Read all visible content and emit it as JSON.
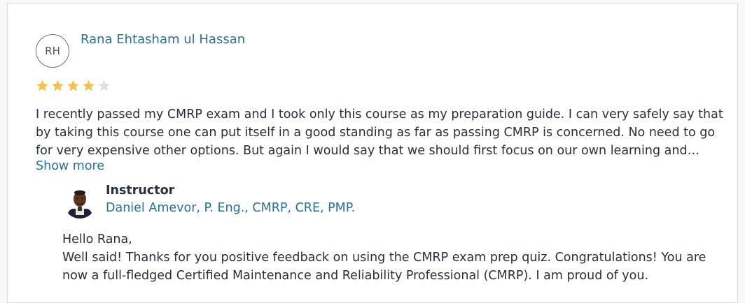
{
  "review": {
    "avatar_initials": "RH",
    "reviewer_name": "Rana Ehtasham ul Hassan",
    "rating": 4,
    "rating_max": 5,
    "colors": {
      "star_filled": "#f4c150",
      "star_empty": "#dedfe0",
      "link": "#29718d",
      "text": "#29303b"
    },
    "text_lines": [
      "I recently passed my CMRP exam and I took only this course as my preparation guide. I can very safely say that",
      "by taking this course one can put itself in a good standing as far as passing CMRP is concerned. No need to go",
      "for very expensive other options. But again I would say that we should first focus on our own learning and…"
    ],
    "show_more_label": "Show more"
  },
  "instructor_response": {
    "title": "Instructor",
    "name": "Daniel Amevor, P. Eng., CMRP, CRE, PMP.",
    "reply_lines": [
      "Hello Rana,",
      "Well said! Thanks for you positive feedback on using the CMRP exam prep quiz. Congratulations! You are",
      "now a full-fledged Certified Maintenance and Reliability Professional (CMRP). I am proud of you."
    ]
  }
}
